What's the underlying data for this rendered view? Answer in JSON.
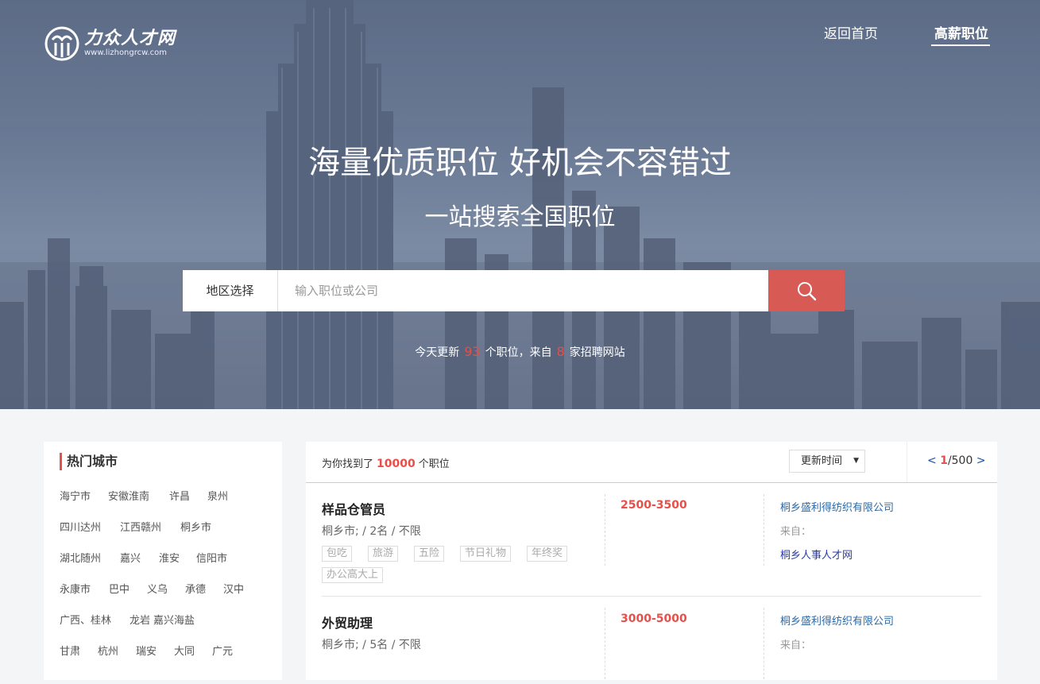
{
  "header": {
    "logo_name": "力众人才网",
    "logo_url": "www.lizhongrcw.com",
    "nav": {
      "home": "返回首页",
      "high_salary": "高薪职位"
    }
  },
  "hero": {
    "title": "海量优质职位 好机会不容错过",
    "subtitle": "一站搜索全国职位"
  },
  "search": {
    "region_label": "地区选择",
    "placeholder": "输入职位或公司",
    "button_icon": "search-icon"
  },
  "stats": {
    "prefix": "今天更新",
    "jobs_count": "93",
    "middle": "个职位，来自",
    "sites_count": "8",
    "suffix": "家招聘网站"
  },
  "sidebar": {
    "title": "热门城市",
    "cities": [
      "海宁市",
      "安徽淮南",
      "许昌",
      "泉州",
      "四川达州",
      "江西赣州",
      "桐乡市",
      "湖北随州",
      "嘉兴",
      "淮安",
      "信阳市",
      "永康市",
      "巴中",
      "义乌",
      "承德",
      "汉中",
      "广西、桂林",
      "龙岩",
      "嘉兴海盐",
      "甘肃",
      "杭州",
      "瑞安",
      "大同",
      "广元"
    ]
  },
  "results": {
    "found_prefix": "为你找到了",
    "found_count": "10000",
    "found_suffix": "个职位",
    "sort_label": "更新时间",
    "pager": {
      "prev": "<",
      "current": "1",
      "total": "/500",
      "next": ">"
    }
  },
  "jobs": [
    {
      "title": "样品仓管员",
      "meta": "桐乡市; / 2名 / 不限",
      "tags": [
        "包吃",
        "旅游",
        "五险",
        "节日礼物",
        "年终奖",
        "办公高大上"
      ],
      "salary": "2500-3500",
      "company": "桐乡盛利得纺织有限公司",
      "from_label": "来自：",
      "source": "桐乡人事人才网"
    },
    {
      "title": "外贸助理",
      "meta": "桐乡市; / 5名 / 不限",
      "tags": [],
      "salary": "3000-5000",
      "company": "桐乡盛利得纺织有限公司",
      "from_label": "来自：",
      "source": ""
    }
  ]
}
